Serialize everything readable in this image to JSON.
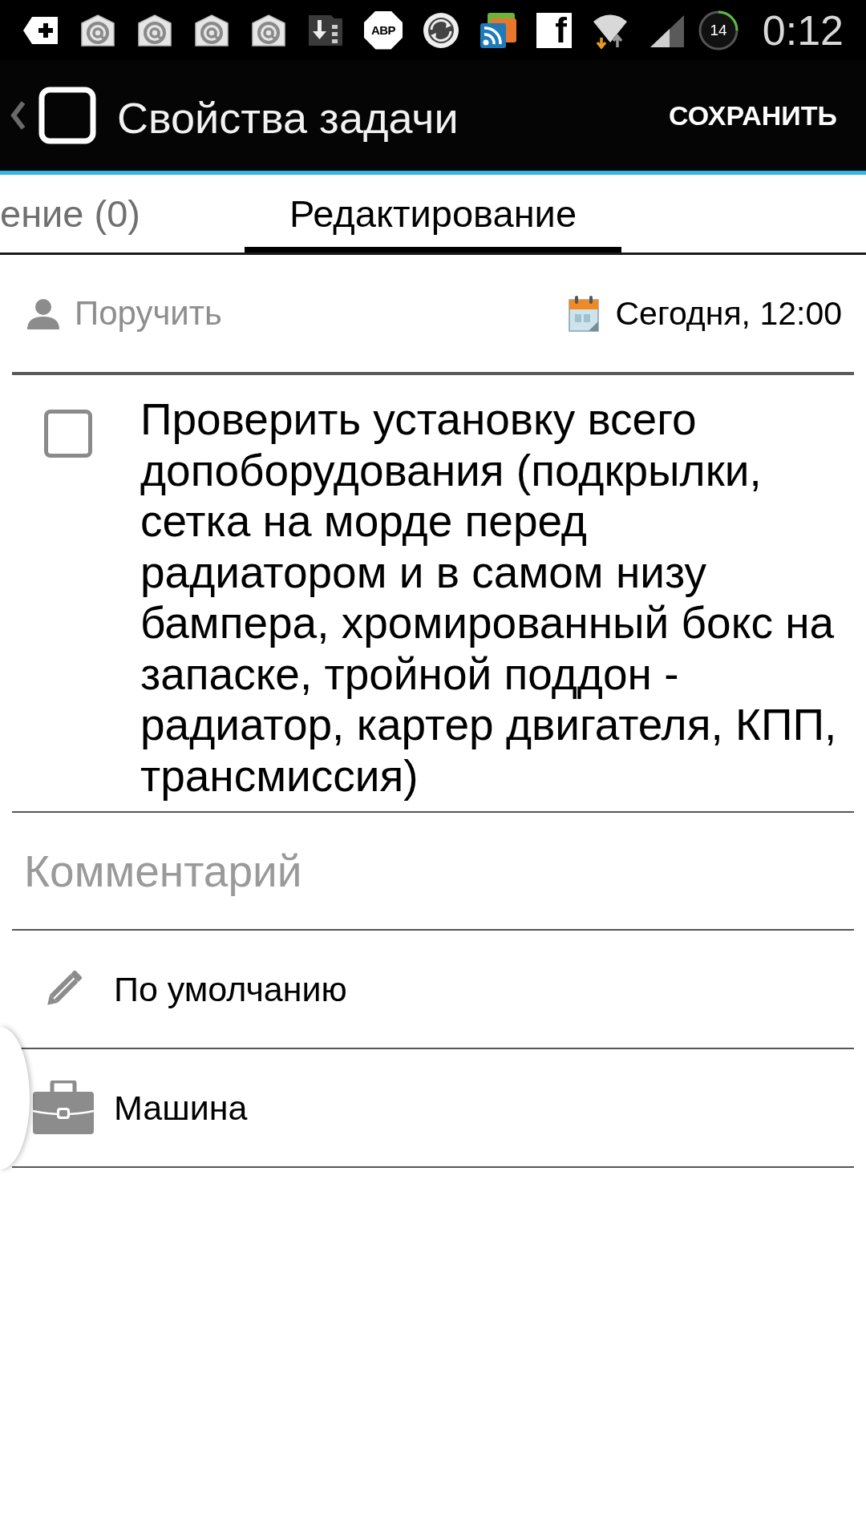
{
  "status_bar": {
    "badge_text": "ABP",
    "logo_letter": "f",
    "battery": "14",
    "time": "0:12"
  },
  "action_bar": {
    "title": "Свойства задачи",
    "action": "СОХРАНИТЬ"
  },
  "tabs": [
    {
      "label": "ение (0)",
      "selected": false
    },
    {
      "label": "Редактирование",
      "selected": true
    }
  ],
  "assign": {
    "label": "Поручить"
  },
  "due": {
    "label": "Сегодня, 12:00"
  },
  "task": {
    "checked": false,
    "text": "Проверить установку всего допоборудования (подкрылки, сетка на морде перед радиатором и в самом низу бампера, хромированный бокс на запаске, тройной поддон - радиатор, картер двигателя, КПП, трансмиссия)"
  },
  "comment": {
    "placeholder": "Комментарий"
  },
  "properties": [
    {
      "kind": "pencil",
      "label": "По умолчанию"
    },
    {
      "kind": "briefcase",
      "label": "Машина"
    }
  ]
}
